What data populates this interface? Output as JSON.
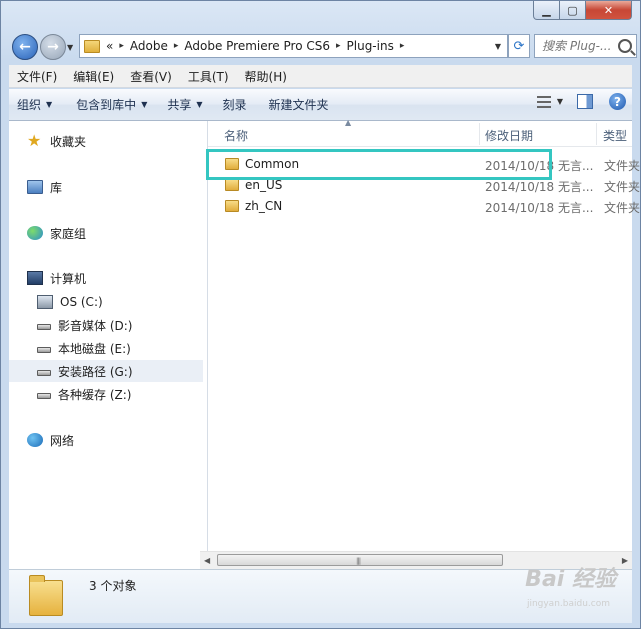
{
  "address": {
    "overflow_chevron": "«",
    "crumbs": [
      "Adobe",
      "Adobe Premiere Pro CS6",
      "Plug-ins"
    ]
  },
  "search": {
    "placeholder": "搜索 Plug-..."
  },
  "menubar": [
    "文件(F)",
    "编辑(E)",
    "查看(V)",
    "工具(T)",
    "帮助(H)"
  ],
  "toolbar": {
    "organize": "组织",
    "include_library": "包含到库中",
    "share": "共享",
    "burn": "刻录",
    "new_folder": "新建文件夹"
  },
  "nav_pane": {
    "favorites": "收藏夹",
    "libraries": "库",
    "homegroup": "家庭组",
    "computer": "计算机",
    "drives": [
      "OS (C:)",
      "影音媒体 (D:)",
      "本地磁盘 (E:)",
      "安装路径 (G:)",
      "各种缓存 (Z:)"
    ],
    "network": "网络"
  },
  "columns": {
    "name": "名称",
    "modified": "修改日期",
    "type": "类型"
  },
  "files": [
    {
      "name": "Common",
      "modified": "2014/10/18 无言...",
      "type": "文件夹"
    },
    {
      "name": "en_US",
      "modified": "2014/10/18 无言...",
      "type": "文件夹"
    },
    {
      "name": "zh_CN",
      "modified": "2014/10/18 无言...",
      "type": "文件夹"
    }
  ],
  "status": {
    "count": "3 个对象"
  },
  "watermark": {
    "main": "Bai 经验",
    "sub": "jingyan.baidu.com"
  },
  "colors": {
    "highlight_box": "#34c6c1",
    "selected_nav": "#eaeff6"
  }
}
